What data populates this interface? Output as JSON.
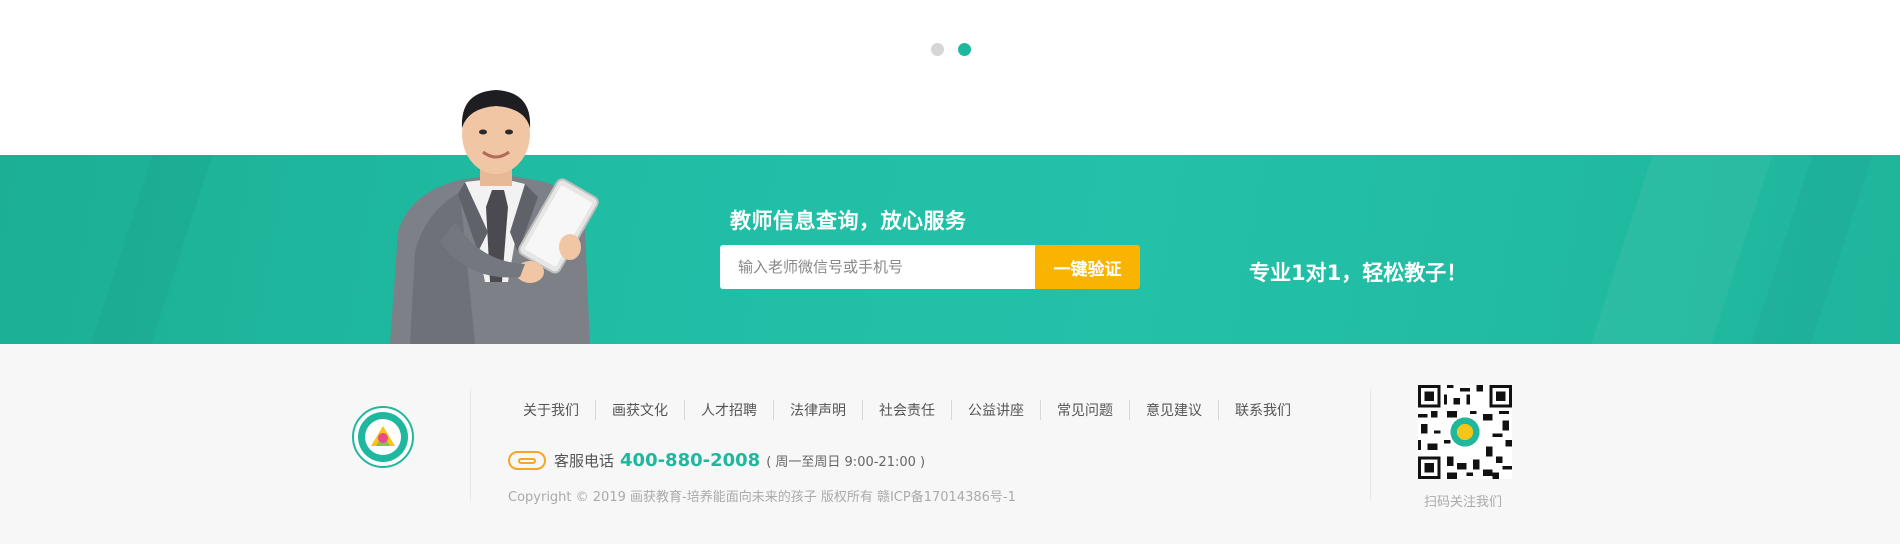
{
  "carousel": {
    "dots": [
      {
        "state": "inactive"
      },
      {
        "state": "active"
      }
    ]
  },
  "banner": {
    "title": "教师信息查询，放心服务",
    "search_placeholder": "输入老师微信号或手机号",
    "verify_button": "一键验证",
    "slogan": "专业1对1，轻松教子！"
  },
  "footer": {
    "links": [
      "关于我们",
      "画获文化",
      "人才招聘",
      "法律声明",
      "社会责任",
      "公益讲座",
      "常见问题",
      "意见建议",
      "联系我们"
    ],
    "phone_label": "客服电话",
    "phone_number": "400-880-2008",
    "phone_hours": "( 周一至周日 9:00-21:00 )",
    "copyright": "Copyright © 2019 画获教育-培养能面向未来的孩子 版权所有 赣ICP备17014386号-1",
    "qr_caption": "扫码关注我们"
  },
  "colors": {
    "accent": "#1fb89e",
    "button": "#f8b400",
    "footer_bg": "#f7f7f7"
  }
}
